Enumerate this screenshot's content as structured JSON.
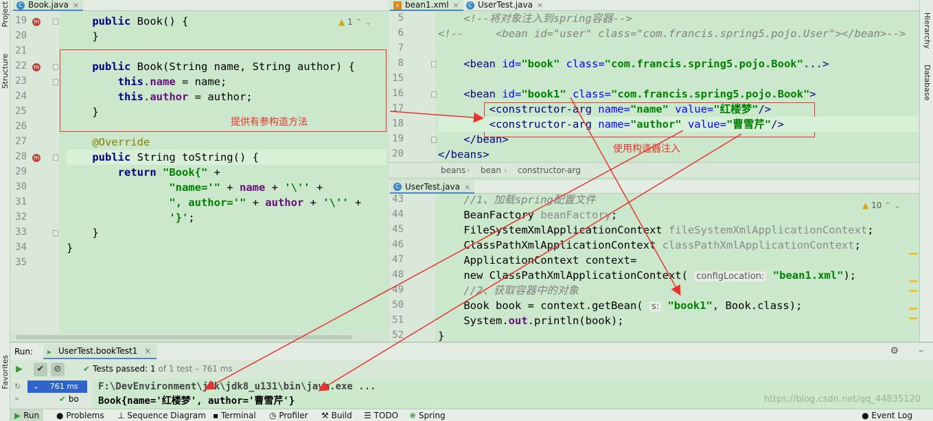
{
  "left_strip": {
    "project": "Project",
    "structure": "Structure",
    "favorites": "Favorites"
  },
  "right_strip": {
    "hierarchy": "Hierarchy",
    "database": "Database"
  },
  "left_editor": {
    "tab": "Book.java",
    "warnings": "1",
    "annotation": "提供有参构造方法",
    "lines": [
      {
        "n": "19",
        "code": [
          {
            "t": "    "
          },
          {
            "t": "public",
            "c": "kw"
          },
          {
            "t": " Book() {"
          }
        ]
      },
      {
        "n": "20",
        "code": [
          {
            "t": "    }"
          }
        ]
      },
      {
        "n": "21",
        "code": []
      },
      {
        "n": "22",
        "code": [
          {
            "t": "    "
          },
          {
            "t": "public",
            "c": "kw"
          },
          {
            "t": " Book(String name, String author) {"
          }
        ]
      },
      {
        "n": "23",
        "code": [
          {
            "t": "        "
          },
          {
            "t": "this",
            "c": "kw"
          },
          {
            "t": "."
          },
          {
            "t": "name",
            "c": "fld"
          },
          {
            "t": " = name;"
          }
        ]
      },
      {
        "n": "24",
        "code": [
          {
            "t": "        "
          },
          {
            "t": "this",
            "c": "kw"
          },
          {
            "t": "."
          },
          {
            "t": "author",
            "c": "fld"
          },
          {
            "t": " = author;"
          }
        ]
      },
      {
        "n": "25",
        "code": [
          {
            "t": "    }"
          }
        ]
      },
      {
        "n": "26",
        "code": []
      },
      {
        "n": "27",
        "code": [
          {
            "t": "    "
          },
          {
            "t": "@Override",
            "c": "ann"
          }
        ]
      },
      {
        "n": "28",
        "code": [
          {
            "t": "    "
          },
          {
            "t": "public",
            "c": "kw"
          },
          {
            "t": " String toString() {"
          }
        ]
      },
      {
        "n": "29",
        "code": [
          {
            "t": "        "
          },
          {
            "t": "return",
            "c": "kw"
          },
          {
            "t": " "
          },
          {
            "t": "\"Book{\"",
            "c": "str"
          },
          {
            "t": " +"
          }
        ]
      },
      {
        "n": "30",
        "code": [
          {
            "t": "                "
          },
          {
            "t": "\"name='\"",
            "c": "str"
          },
          {
            "t": " + "
          },
          {
            "t": "name",
            "c": "fld"
          },
          {
            "t": " + "
          },
          {
            "t": "'\\''",
            "c": "str"
          },
          {
            "t": " +"
          }
        ]
      },
      {
        "n": "31",
        "code": [
          {
            "t": "                "
          },
          {
            "t": "\", author='\"",
            "c": "str"
          },
          {
            "t": " + "
          },
          {
            "t": "author",
            "c": "fld"
          },
          {
            "t": " + "
          },
          {
            "t": "'\\''",
            "c": "str"
          },
          {
            "t": " +"
          }
        ]
      },
      {
        "n": "32",
        "code": [
          {
            "t": "                "
          },
          {
            "t": "'}'",
            "c": "str"
          },
          {
            "t": ";"
          }
        ]
      },
      {
        "n": "33",
        "code": [
          {
            "t": "    }"
          }
        ]
      },
      {
        "n": "34",
        "code": [
          {
            "t": "}"
          }
        ]
      },
      {
        "n": "35",
        "code": []
      }
    ]
  },
  "xml_editor": {
    "tabs": [
      "bean1.xml",
      "UserTest.java"
    ],
    "annotation": "使用构造器注入",
    "breadcrumb": [
      "beans",
      "bean",
      "constructor-arg"
    ],
    "lines": [
      {
        "n": "5",
        "code": [
          {
            "t": "    "
          },
          {
            "t": "<!--将对象注入到spring容器-->",
            "c": "gr"
          }
        ]
      },
      {
        "n": "6",
        "code": [
          {
            "t": "<!--     <bean id=\"user\" class=\"com.francis.spring5.pojo.User\"></bean>-->",
            "c": "gr"
          }
        ]
      },
      {
        "n": "7",
        "code": []
      },
      {
        "n": "8",
        "code": [
          {
            "t": "    "
          },
          {
            "t": "<bean ",
            "c": "tag"
          },
          {
            "t": "id=",
            "c": "attr"
          },
          {
            "t": "\"book\"",
            "c": "str"
          },
          {
            "t": " class=",
            "c": "attr"
          },
          {
            "t": "\"com.francis.spring5.pojo.Book\"",
            "c": "str"
          },
          {
            "t": "...>",
            "c": "tag"
          }
        ]
      },
      {
        "n": "15",
        "code": []
      },
      {
        "n": "16",
        "code": [
          {
            "t": "    "
          },
          {
            "t": "<bean ",
            "c": "tag"
          },
          {
            "t": "id=",
            "c": "attr"
          },
          {
            "t": "\"book1\"",
            "c": "str"
          },
          {
            "t": " class=",
            "c": "attr"
          },
          {
            "t": "\"com.francis.spring5.pojo.Book\"",
            "c": "str"
          },
          {
            "t": ">",
            "c": "tag"
          }
        ]
      },
      {
        "n": "17",
        "code": [
          {
            "t": "        "
          },
          {
            "t": "<constructor-arg ",
            "c": "tag"
          },
          {
            "t": "name=",
            "c": "attr"
          },
          {
            "t": "\"name\"",
            "c": "str"
          },
          {
            "t": " value=",
            "c": "attr"
          },
          {
            "t": "\"红楼梦\"",
            "c": "str"
          },
          {
            "t": "/>",
            "c": "tag"
          }
        ]
      },
      {
        "n": "18",
        "code": [
          {
            "t": "        "
          },
          {
            "t": "<constructor-arg ",
            "c": "tag"
          },
          {
            "t": "name=",
            "c": "attr"
          },
          {
            "t": "\"author\"",
            "c": "str"
          },
          {
            "t": " value=",
            "c": "attr"
          },
          {
            "t": "\"曹雪芹\"",
            "c": "str"
          },
          {
            "t": "/>",
            "c": "tag"
          }
        ]
      },
      {
        "n": "19",
        "code": [
          {
            "t": "    "
          },
          {
            "t": "</bean>",
            "c": "tag"
          }
        ]
      },
      {
        "n": "20",
        "code": [
          {
            "t": "</beans>",
            "c": "tag"
          }
        ]
      }
    ]
  },
  "test_editor": {
    "tab": "UserTest.java",
    "warnings": "10",
    "lines": [
      {
        "n": "43",
        "code": [
          {
            "t": "    "
          },
          {
            "t": "//1、加载spring配置文件",
            "c": "gr"
          }
        ]
      },
      {
        "n": "44",
        "code": [
          {
            "t": "    BeanFactory "
          },
          {
            "t": "beanFactory",
            "c": "iv"
          },
          {
            "t": ";"
          }
        ]
      },
      {
        "n": "45",
        "code": [
          {
            "t": "    FileSystemXmlApplicationContext "
          },
          {
            "t": "fileSystemXmlApplicationContext",
            "c": "iv"
          },
          {
            "t": ";"
          }
        ]
      },
      {
        "n": "46",
        "code": [
          {
            "t": "    ClassPathXmlApplicationContext "
          },
          {
            "t": "classPathXmlApplicationContext",
            "c": "iv"
          },
          {
            "t": ";"
          }
        ]
      },
      {
        "n": "47",
        "code": [
          {
            "t": "    ApplicationContext context="
          }
        ]
      },
      {
        "n": "48",
        "code": [
          {
            "t": "    new ClassPathXmlApplicationContext( "
          },
          {
            "t": "configLocation:",
            "c": "hint"
          },
          {
            "t": " "
          },
          {
            "t": "\"bean1.xml\"",
            "c": "str"
          },
          {
            "t": ");"
          }
        ]
      },
      {
        "n": "49",
        "code": [
          {
            "t": "    "
          },
          {
            "t": "//2、获取容器中的对象",
            "c": "gr"
          }
        ]
      },
      {
        "n": "50",
        "code": [
          {
            "t": "    Book book = context.getBean( "
          },
          {
            "t": "s:",
            "c": "hint"
          },
          {
            "t": " "
          },
          {
            "t": "\"book1\"",
            "c": "str"
          },
          {
            "t": ", Book.class);"
          }
        ]
      },
      {
        "n": "51",
        "code": [
          {
            "t": "    System."
          },
          {
            "t": "out",
            "c": "fld"
          },
          {
            "t": ".println(book);"
          }
        ]
      },
      {
        "n": "52",
        "code": [
          {
            "t": "}"
          }
        ]
      }
    ]
  },
  "run": {
    "label": "Run:",
    "config": "UserTest.bookTest1",
    "status": "Tests passed:",
    "passed": "1",
    "of": "of 1 test – 761 ms",
    "tree_root_time": "761 ms",
    "tree_child": "bo",
    "console_line1": "F:\\DevEnvironment\\jdk\\jdk8_u131\\bin\\java.exe ...",
    "console_line2": "Book{name='红楼梦', author='曹雪芹'}"
  },
  "bottom": {
    "items": [
      "Run",
      "Problems",
      "Sequence Diagram",
      "Terminal",
      "Profiler",
      "Build",
      "TODO",
      "Spring"
    ],
    "event_log": "Event Log",
    "watermark": "https://blog.csdn.net/qq_44835120"
  }
}
